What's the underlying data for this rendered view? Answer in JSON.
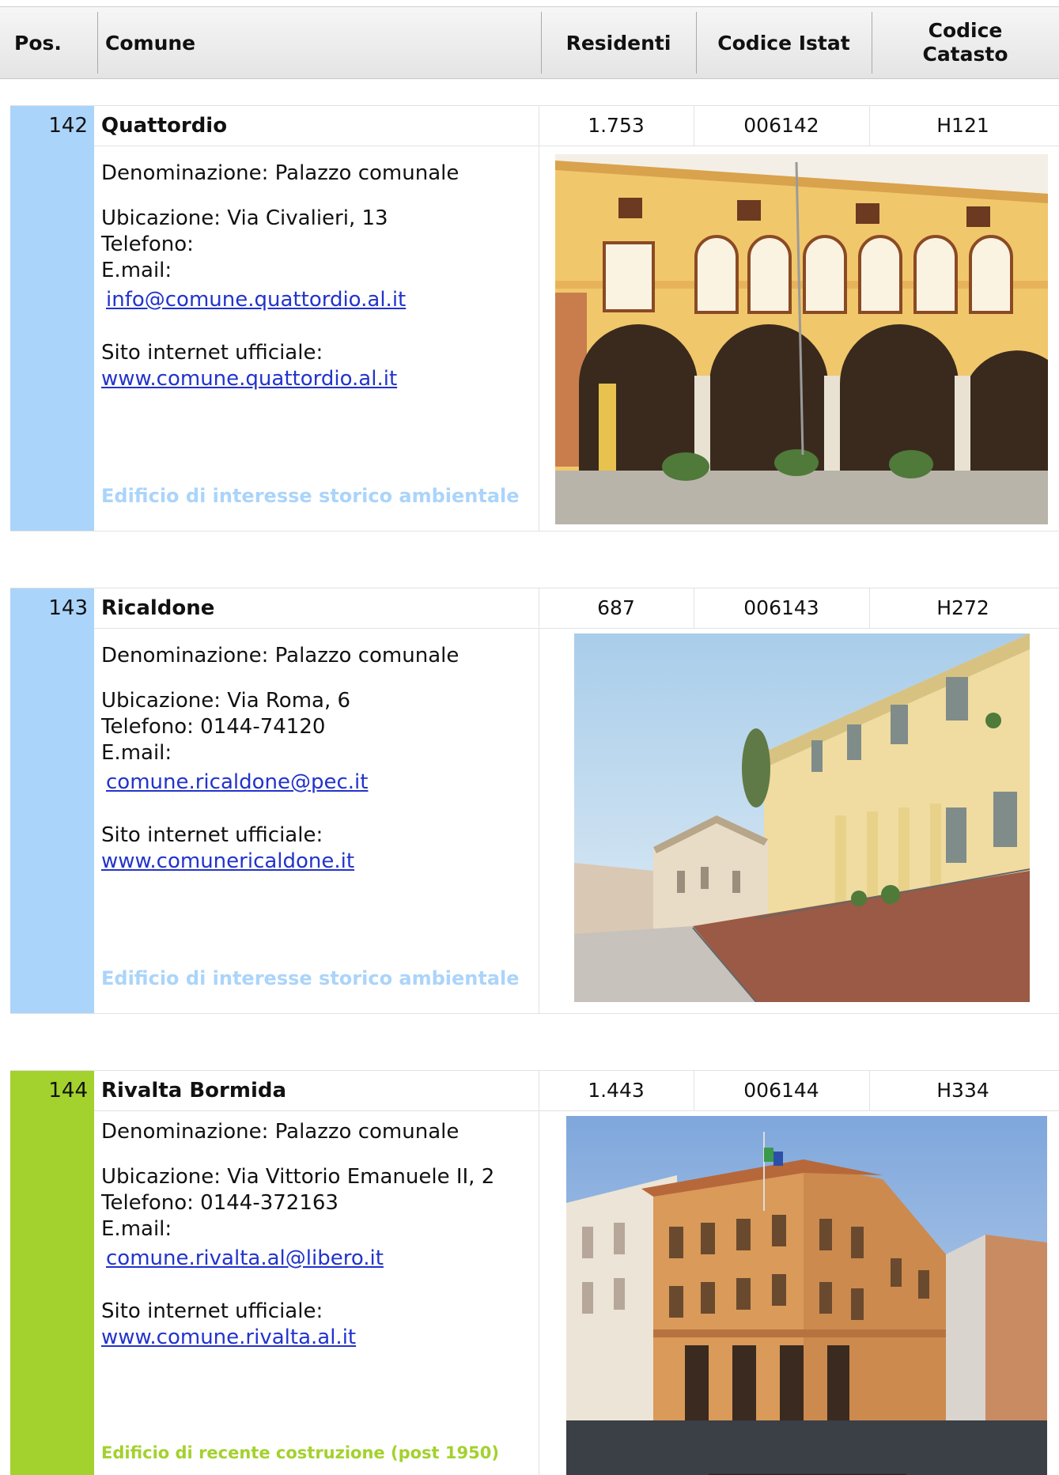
{
  "header": {
    "pos": "Pos.",
    "comune": "Comune",
    "residenti": "Residenti",
    "codice_istat": "Codice Istat",
    "codice_catasto_1": "Codice",
    "codice_catasto_2": "Catasto"
  },
  "records": [
    {
      "pos": "142",
      "name": "Quattordio",
      "residenti": "1.753",
      "istat": "006142",
      "catasto": "H121",
      "denominazione": "Denominazione: Palazzo comunale",
      "ubicazione": "Ubicazione: Via Civalieri, 13",
      "telefono": "Telefono:",
      "email_label": "E.mail:",
      "email": "info@comune.quattordio.al.it",
      "sito_label": "Sito internet ufficiale:",
      "sito": "www.comune.quattordio.al.it",
      "status": "Edificio di interesse storico ambientale",
      "stripe_color": "#abd4fa",
      "status_color": "#abd4fa",
      "photo_alt": "Palazzo comunale di Quattordio"
    },
    {
      "pos": "143",
      "name": "Ricaldone",
      "residenti": "687",
      "istat": "006143",
      "catasto": "H272",
      "denominazione": "Denominazione: Palazzo comunale",
      "ubicazione": "Ubicazione: Via Roma, 6",
      "telefono": "Telefono: 0144-74120",
      "email_label": "E.mail:",
      "email": "comune.ricaldone@pec.it",
      "sito_label": "Sito internet ufficiale:",
      "sito": "www.comunericaldone.it",
      "status": "Edificio di interesse storico ambientale",
      "stripe_color": "#abd4fa",
      "status_color": "#abd4fa",
      "photo_alt": "Palazzo comunale di Ricaldone"
    },
    {
      "pos": "144",
      "name": "Rivalta Bormida",
      "residenti": "1.443",
      "istat": "006144",
      "catasto": "H334",
      "denominazione": "Denominazione: Palazzo comunale",
      "ubicazione": "Ubicazione: Via Vittorio Emanuele II, 2",
      "telefono": "Telefono: 0144-372163",
      "email_label": "E.mail:",
      "email": "comune.rivalta.al@libero.it",
      "sito_label": "Sito internet ufficiale:",
      "sito": "www.comune.rivalta.al.it",
      "status": "Edificio di recente costruzione (post 1950)",
      "stripe_color": "#a3d12e",
      "status_color": "#a3d12e",
      "photo_alt": "Palazzo comunale di Rivalta Bormida"
    }
  ]
}
